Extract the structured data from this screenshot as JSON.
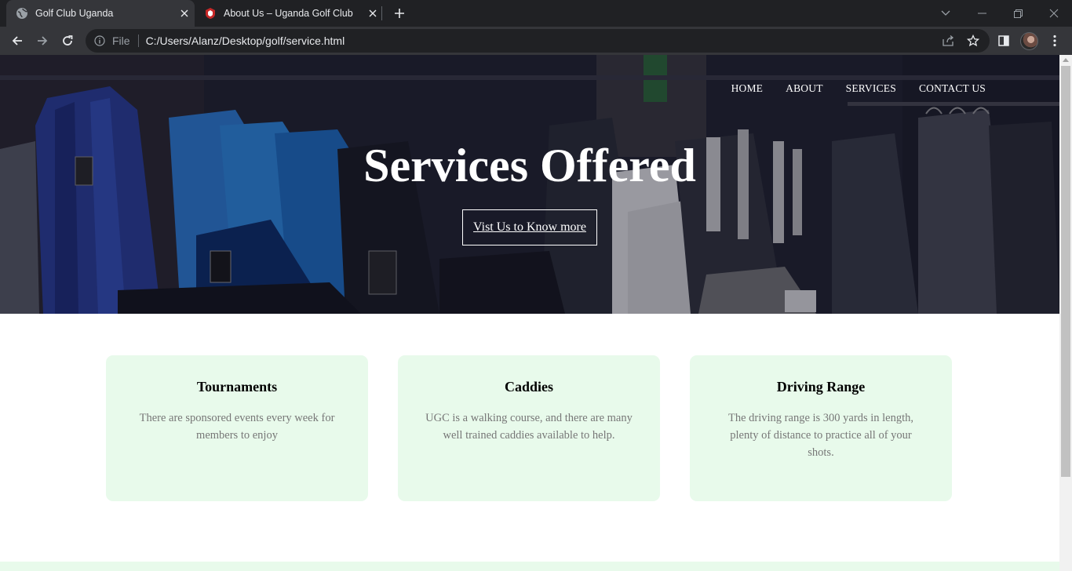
{
  "browser": {
    "tabs": [
      {
        "title": "Golf Club Uganda",
        "icon": "globe-icon",
        "active": true
      },
      {
        "title": "About Us – Uganda Golf Club",
        "icon": "golf-club-logo-icon",
        "active": false
      }
    ],
    "address": {
      "scheme_label": "File",
      "url": "C:/Users/Alanz/Desktop/golf/service.html"
    }
  },
  "nav": {
    "items": [
      "HOME",
      "ABOUT",
      "SERVICES",
      "CONTACT US"
    ]
  },
  "hero": {
    "title": "Services Offered",
    "button_label": "Vist Us to Know more"
  },
  "services": [
    {
      "title": "Tournaments",
      "text": "There are sponsored events every week for members to enjoy"
    },
    {
      "title": "Caddies",
      "text": "UGC is a walking course, and there are many well trained caddies available to help."
    },
    {
      "title": "Driving Range",
      "text": "The driving range is 300 yards in length, plenty of distance to practice all of your shots."
    }
  ],
  "colors": {
    "card_background": "#e8faeb",
    "chrome_dark": "#202124",
    "chrome_toolbar": "#35363a"
  }
}
